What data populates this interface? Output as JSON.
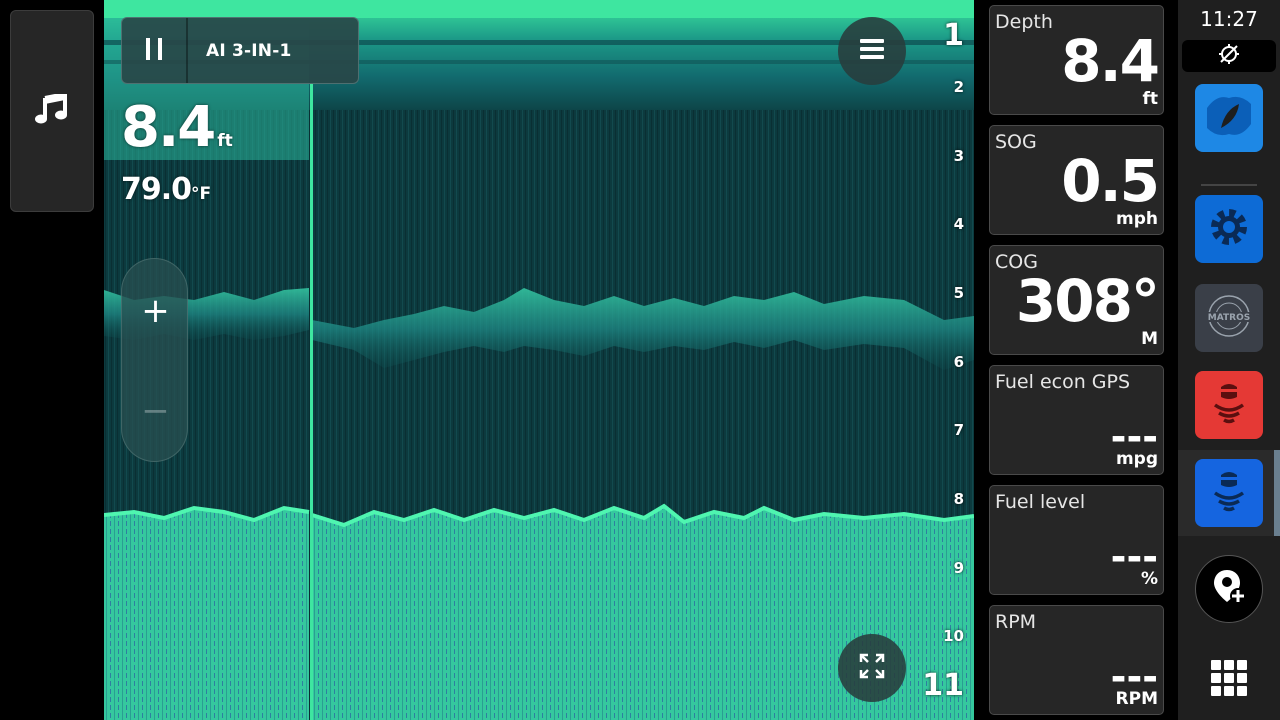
{
  "sonar": {
    "source_label": "AI 3-IN-1",
    "depth_value": "8.4",
    "depth_unit": "ft",
    "temp_value": "79.0",
    "temp_unit": "°F",
    "zoom_in_label": "+",
    "zoom_out_label": "−",
    "depth_scale": [
      "1",
      "2",
      "3",
      "4",
      "5",
      "6",
      "7",
      "8",
      "9",
      "10",
      "11"
    ]
  },
  "instruments": [
    {
      "label": "Depth",
      "value": "8.4",
      "unit": "ft"
    },
    {
      "label": "SOG",
      "value": "0.5",
      "unit": "mph"
    },
    {
      "label": "COG",
      "value": "308°",
      "unit": "M"
    },
    {
      "label": "Fuel econ GPS",
      "value": "---",
      "unit": "mpg"
    },
    {
      "label": "Fuel level",
      "value": "---",
      "unit": "%"
    },
    {
      "label": "RPM",
      "value": "---",
      "unit": "RPM"
    }
  ],
  "appbar": {
    "time": "11:27",
    "apps": [
      {
        "icon": "chart-icon",
        "color": "#1e88e5"
      },
      {
        "icon": "settings-gear-icon",
        "color": "#0d6bd6"
      },
      {
        "icon": "matros-logo-icon",
        "color": "#3a3f48",
        "text": "MATROS"
      },
      {
        "icon": "sonar-transducer-icon",
        "color": "#e53935"
      },
      {
        "icon": "sonar-transducer-icon",
        "color": "#1565e0"
      }
    ]
  },
  "colors": {
    "sonar_dark": "#0c3a3e",
    "sonar_bright": "#3ee6a0",
    "tile_bg": "#262626"
  }
}
